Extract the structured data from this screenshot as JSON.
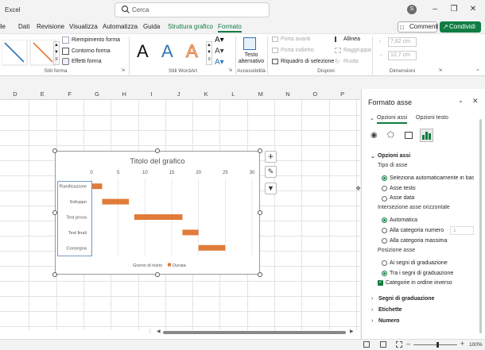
{
  "window": {
    "app_name": "Excel",
    "search_placeholder": "Cerca",
    "avatar_initial": "S"
  },
  "menu": {
    "tabs": [
      "Dati",
      "Revisione",
      "Visualizza",
      "Automatizza",
      "Guida",
      "Struttura grafico",
      "Formato"
    ],
    "partial_tab": "ile",
    "active_tab": "Formato",
    "comments_label": "Commenti",
    "share_label": "Condividi"
  },
  "ribbon": {
    "stili_forma": {
      "label": "Stili forma",
      "fill": "Riempimento forma",
      "outline": "Contorno forma",
      "effects": "Effetti forma"
    },
    "wordart": {
      "label": "Stili WordArt",
      "letter": "A"
    },
    "accessibilita": {
      "label": "Accessibilità",
      "alt_text_1": "Testo",
      "alt_text_2": "alternativo"
    },
    "disponi": {
      "label": "Disponi",
      "forward": "Porta avanti",
      "backward": "Porta indietro",
      "selection_pane": "Riquadro di selezione",
      "align": "Allinea",
      "group": "Raggruppa",
      "rotate": "Ruota"
    },
    "dimensioni": {
      "label": "Dimensioni",
      "height": "7,62 cm",
      "width": "12,7 cm"
    }
  },
  "sheet": {
    "columns": [
      "D",
      "E",
      "F",
      "G",
      "H",
      "I",
      "J",
      "K",
      "L",
      "M",
      "N",
      "O",
      "P"
    ]
  },
  "chart_data": {
    "type": "bar",
    "title": "Titolo del grafico",
    "orientation": "horizontal-stacked",
    "categories": [
      "Pianificazione",
      "Sviluppo",
      "Test prova",
      "Test finali",
      "Consegna"
    ],
    "series": [
      {
        "name": "Giorno di inizio",
        "values": [
          0,
          2,
          8,
          17,
          20
        ],
        "color": "transparent"
      },
      {
        "name": "Durata",
        "values": [
          2,
          5,
          9,
          3,
          5
        ],
        "color": "#e07b39"
      }
    ],
    "xlim": [
      0,
      30
    ],
    "xticks": [
      0,
      5,
      10,
      15,
      20,
      25,
      30
    ],
    "grid": true,
    "legend": "bottom"
  },
  "panel": {
    "title": "Formato asse",
    "tab_axis": "Opzioni assi",
    "tab_text": "Opzioni testo",
    "section_axis_options": "Opzioni assi",
    "axis_type_label": "Tipo di asse",
    "axis_type_options": [
      "Seleziona automaticamente in base a",
      "Asse testo",
      "Asse data"
    ],
    "crossing_label": "Intersezione asse orizzontale",
    "crossing_options": [
      "Automatica",
      "Alla categoria numero",
      "Alla categoria massima"
    ],
    "crossing_number": "1",
    "position_label": "Posizione asse",
    "position_options": [
      "Ai segni di graduazione",
      "Tra i segni di graduazione"
    ],
    "reverse_order": "Categorie in ordine inverso",
    "collapsed_sections": [
      "Segni di graduazione",
      "Etichette",
      "Numero"
    ]
  },
  "status": {
    "zoom": "100%"
  }
}
